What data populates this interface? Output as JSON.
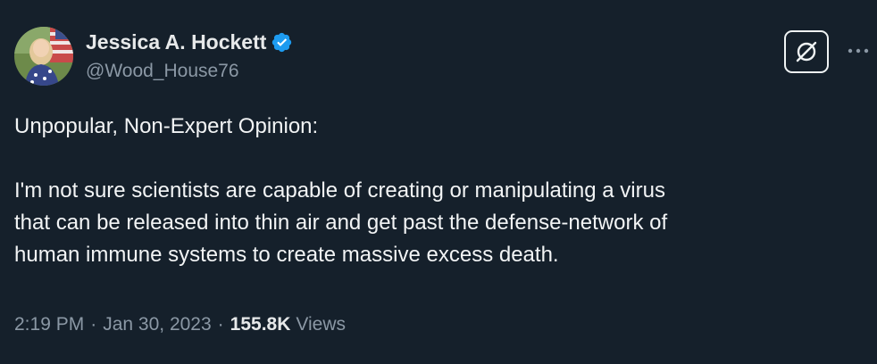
{
  "author": {
    "display_name": "Jessica A. Hockett",
    "handle": "@Wood_House76",
    "verified": true,
    "avatar_icon": "profile-photo"
  },
  "header_actions": {
    "grok_icon": "grok-icon",
    "more_icon": "more-dots-icon"
  },
  "tweet": {
    "lines": [
      "Unpopular, Non-Expert Opinion:",
      "",
      "I'm not sure scientists are capable of creating or manipulating a virus",
      "that can be released into thin air and get past the defense-network of",
      "human immune systems to create massive excess death."
    ]
  },
  "meta": {
    "time": "2:19 PM",
    "separator": "·",
    "date": "Jan 30, 2023",
    "views_count": "155.8K",
    "views_label": "Views"
  },
  "colors": {
    "background": "#15202b",
    "text_primary": "#e7e9ea",
    "text_secondary": "#8b98a5",
    "verified_badge": "#1d9bf0"
  }
}
